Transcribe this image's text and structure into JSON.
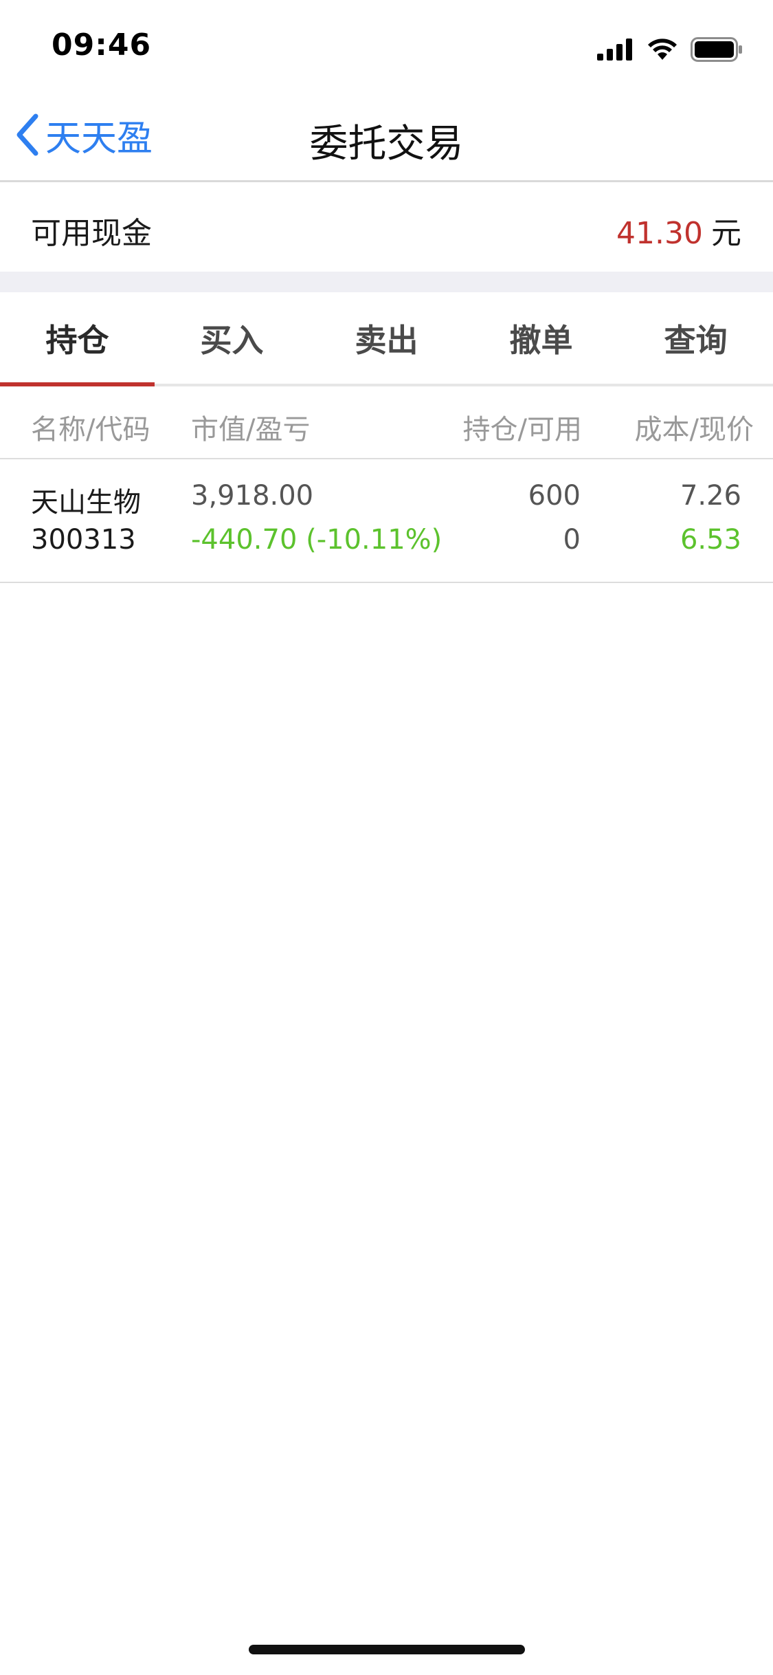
{
  "status_bar": {
    "time": "09:46",
    "icons": [
      "signal-icon",
      "wifi-icon",
      "battery-icon"
    ]
  },
  "nav": {
    "back_label": "天天盈",
    "title": "委托交易"
  },
  "cash": {
    "label": "可用现金",
    "value": "41.30",
    "unit": "元"
  },
  "tabs": [
    {
      "label": "持仓",
      "active": true
    },
    {
      "label": "买入",
      "active": false
    },
    {
      "label": "卖出",
      "active": false
    },
    {
      "label": "撤单",
      "active": false
    },
    {
      "label": "查询",
      "active": false
    }
  ],
  "table": {
    "headers": [
      "名称/代码",
      "市值/盈亏",
      "持仓/可用",
      "成本/现价"
    ],
    "rows": [
      {
        "name": "天山生物",
        "code": "300313",
        "market_value": "3,918.00",
        "profit_loss": "-440.70 (-10.11%)",
        "position": "600",
        "available": "0",
        "cost": "7.26",
        "price": "6.53"
      }
    ]
  },
  "colors": {
    "accent_blue": "#2e7ff0",
    "red": "#c0322e",
    "green": "#5cc22d"
  }
}
